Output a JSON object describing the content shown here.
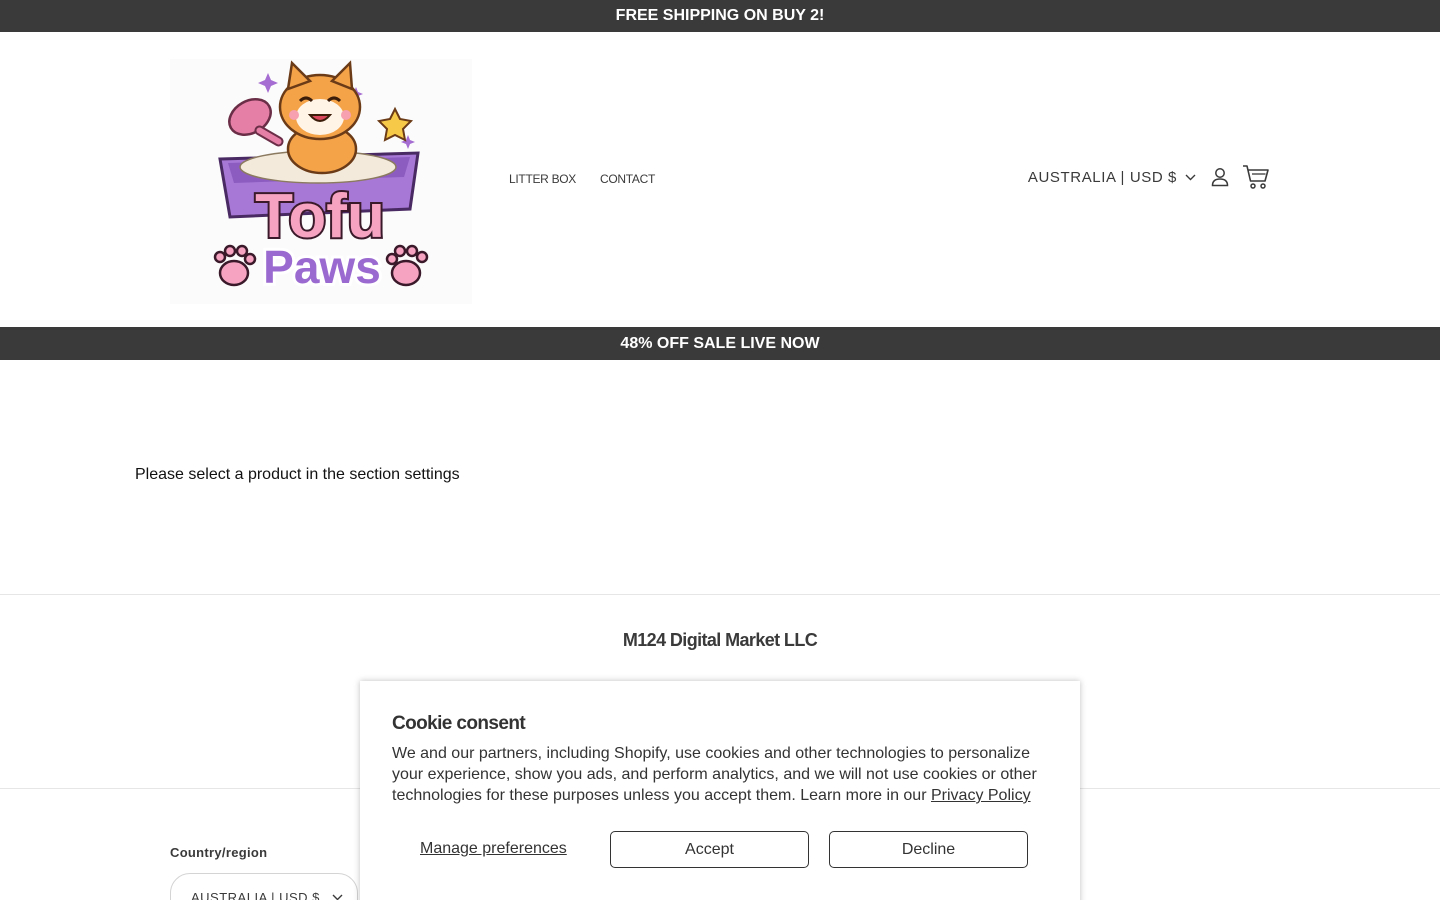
{
  "announcement_top": "FREE SHIPPING ON BUY 2!",
  "announcement_sale": "48% OFF SALE LIVE NOW",
  "header": {
    "logo": {
      "line1": "Tofu",
      "line2": "Paws",
      "icon": "tofu-paws-cat-logo"
    },
    "nav": [
      {
        "label": "LITTER BOX"
      },
      {
        "label": "CONTACT"
      }
    ],
    "localization": "AUSTRALIA | USD $",
    "icons": {
      "account": "account-icon",
      "cart": "cart-icon",
      "chevron": "chevron-down-icon"
    }
  },
  "main": {
    "message": "Please select a product in the section settings"
  },
  "footer": {
    "company": "M124 Digital Market LLC",
    "country_label": "Country/region",
    "country_value": "AUSTRALIA | USD $"
  },
  "cookie": {
    "title": "Cookie consent",
    "body": "We and our partners, including Shopify, use cookies and other technologies to personalize your experience, show you ads, and perform analytics, and we will not use cookies or other technologies for these purposes unless you accept them. Learn more in our ",
    "link": "Privacy Policy",
    "manage": "Manage preferences",
    "accept": "Accept",
    "decline": "Decline"
  },
  "colors": {
    "bar": "#3a3a3a",
    "text": "#121212"
  }
}
